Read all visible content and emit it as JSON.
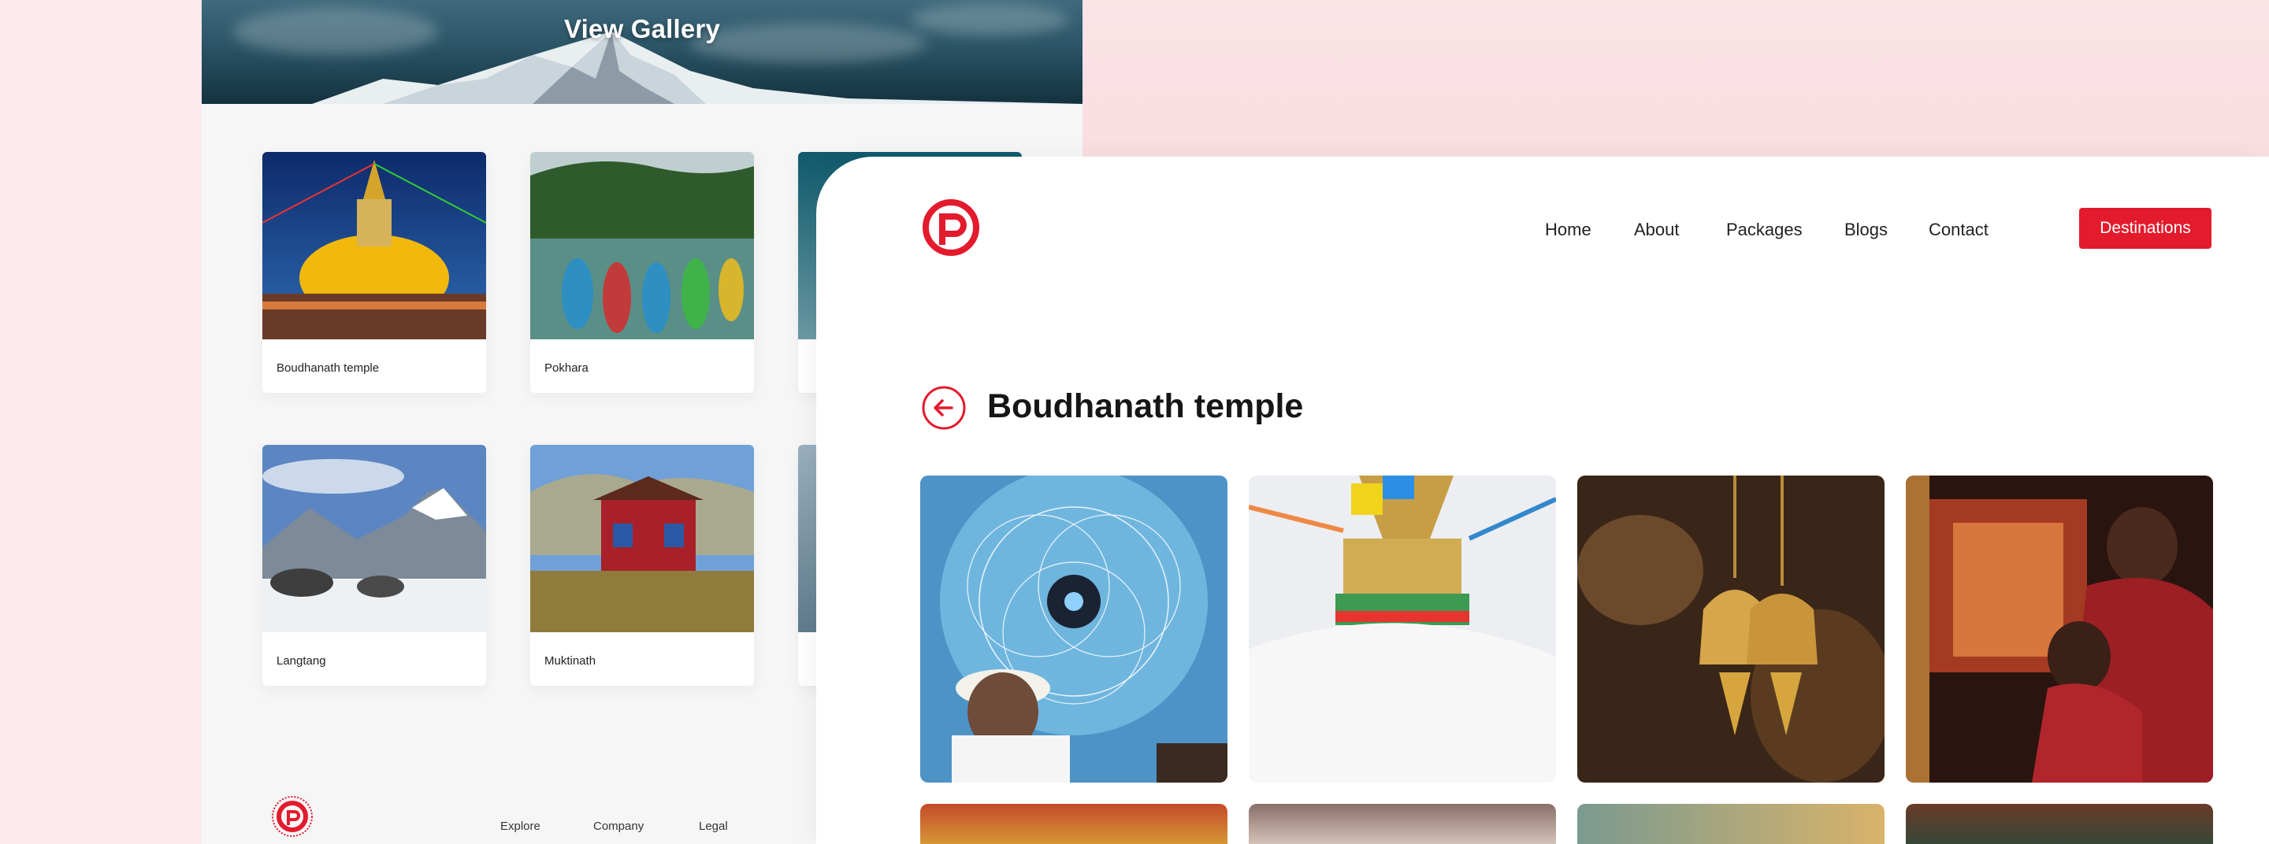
{
  "gallery": {
    "title": "View Gallery",
    "cards": [
      {
        "label": "Boudhanath temple",
        "image": "boudhanath-stupa-photo"
      },
      {
        "label": "Pokhara",
        "image": "pokhara-boats-photo"
      },
      {
        "label": "",
        "image": "partially-hidden-photo"
      },
      {
        "label": "Langtang",
        "image": "langtang-mountains-photo"
      },
      {
        "label": "Muktinath",
        "image": "muktinath-monastery-photo"
      },
      {
        "label": "",
        "image": "partially-hidden-photo"
      }
    ],
    "footer": {
      "links": [
        "Explore",
        "Company",
        "Legal"
      ]
    }
  },
  "header": {
    "logo": "brand-logo-icon",
    "nav": [
      "Home",
      "About",
      "Packages",
      "Blogs",
      "Contact"
    ],
    "cta": "Destinations"
  },
  "detail": {
    "title": "Boudhanath temple",
    "back_icon": "arrow-left-circle-icon",
    "photos": [
      "mandala-painter-photo",
      "stupa-prayer-flags-photo",
      "brass-bells-photo",
      "monks-praying-photo",
      "temple-gate-photo",
      "crowd-photo",
      "blurred-warm-photo",
      "building-photo"
    ]
  },
  "colors": {
    "brand_red": "#e31b2d",
    "page_bg": "#fde9ec"
  }
}
